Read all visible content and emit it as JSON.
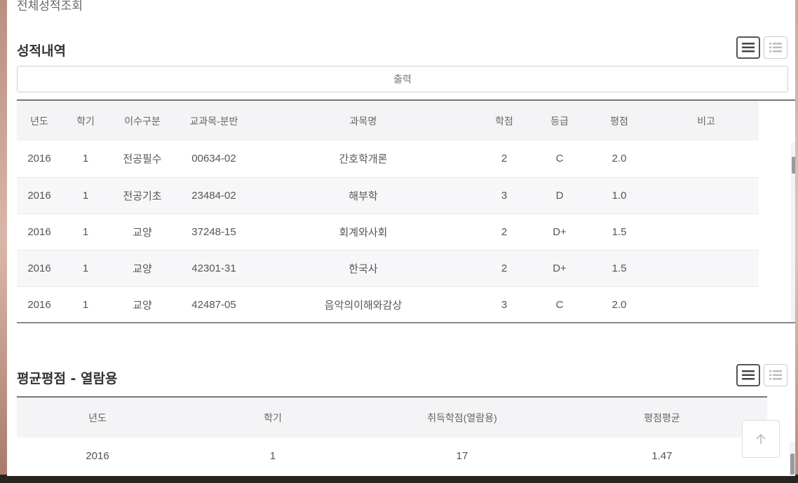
{
  "page": {
    "top_title_cut": "전체성적조회"
  },
  "grades": {
    "title": "성적내역",
    "print_label": "출력",
    "columns": [
      "년도",
      "학기",
      "이수구분",
      "교과목-분반",
      "과목명",
      "학점",
      "등급",
      "평점",
      "비고"
    ],
    "rows": [
      [
        "2016",
        "1",
        "전공필수",
        "00634-02",
        "간호학개론",
        "2",
        "C",
        "2.0",
        ""
      ],
      [
        "2016",
        "1",
        "전공기초",
        "23484-02",
        "해부학",
        "3",
        "D",
        "1.0",
        ""
      ],
      [
        "2016",
        "1",
        "교양",
        "37248-15",
        "회계와사회",
        "2",
        "D+",
        "1.5",
        ""
      ],
      [
        "2016",
        "1",
        "교양",
        "42301-31",
        "한국사",
        "2",
        "D+",
        "1.5",
        ""
      ],
      [
        "2016",
        "1",
        "교양",
        "42487-05",
        "음악의이해와감상",
        "3",
        "C",
        "2.0",
        ""
      ]
    ]
  },
  "average": {
    "title": "평균평점 - 열람용",
    "columns": [
      "년도",
      "학기",
      "취득학점(열람용)",
      "평점평균"
    ],
    "rows": [
      [
        "2016",
        "1",
        "17",
        "1.47"
      ]
    ]
  },
  "icons": {
    "list_view": "list-view-icon",
    "grid_view": "grid-view-icon",
    "scroll_top": "arrow-up-icon"
  }
}
